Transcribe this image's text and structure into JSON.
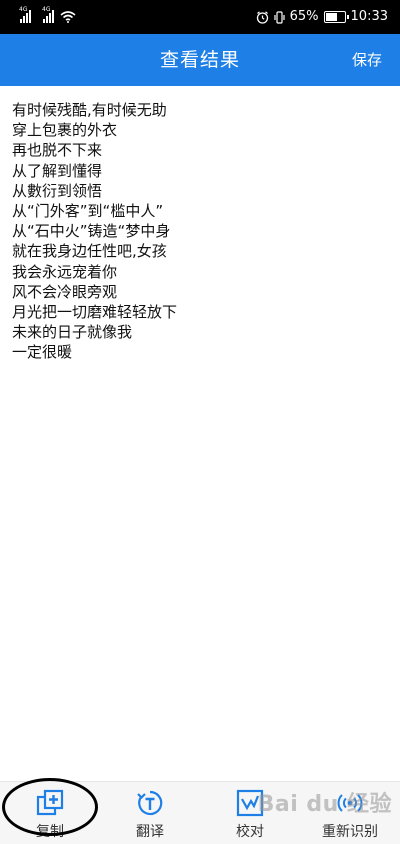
{
  "status_bar": {
    "network_tag_1": "4G",
    "network_tag_2": "4G",
    "battery_percent": "65%",
    "time": "10:33",
    "icons": [
      "signal-icon",
      "signal-icon",
      "wifi-icon",
      "alarm-icon",
      "vibrate-icon",
      "battery-icon"
    ],
    "battery_level": 0.65
  },
  "header": {
    "title": "查看结果",
    "save_label": "保存",
    "background_color": "#1e7fe6"
  },
  "result_lines": [
    "有时候残酷,有时候无助",
    "穿上包裹的外衣",
    "再也脱不下来",
    "从了解到懂得",
    "从數衍到领悟",
    "从“门外客”到“槛中人”",
    "从“石中火”铸造“梦中身",
    "就在我身边任性吧,女孩",
    "我会永远宠着你",
    "风不会冷眼旁观",
    "月光把一切磨难轻轻放下",
    "未来的日子就像我",
    "一定很暖"
  ],
  "toolbar": {
    "items": [
      {
        "label": "复制",
        "icon": "copy-icon"
      },
      {
        "label": "翻译",
        "icon": "translate-icon"
      },
      {
        "label": "校对",
        "icon": "proofread-icon"
      },
      {
        "label": "重新识别",
        "icon": "rescan-icon"
      }
    ],
    "icon_color": "#1e7fe6"
  },
  "watermark": "Bai du 经验"
}
